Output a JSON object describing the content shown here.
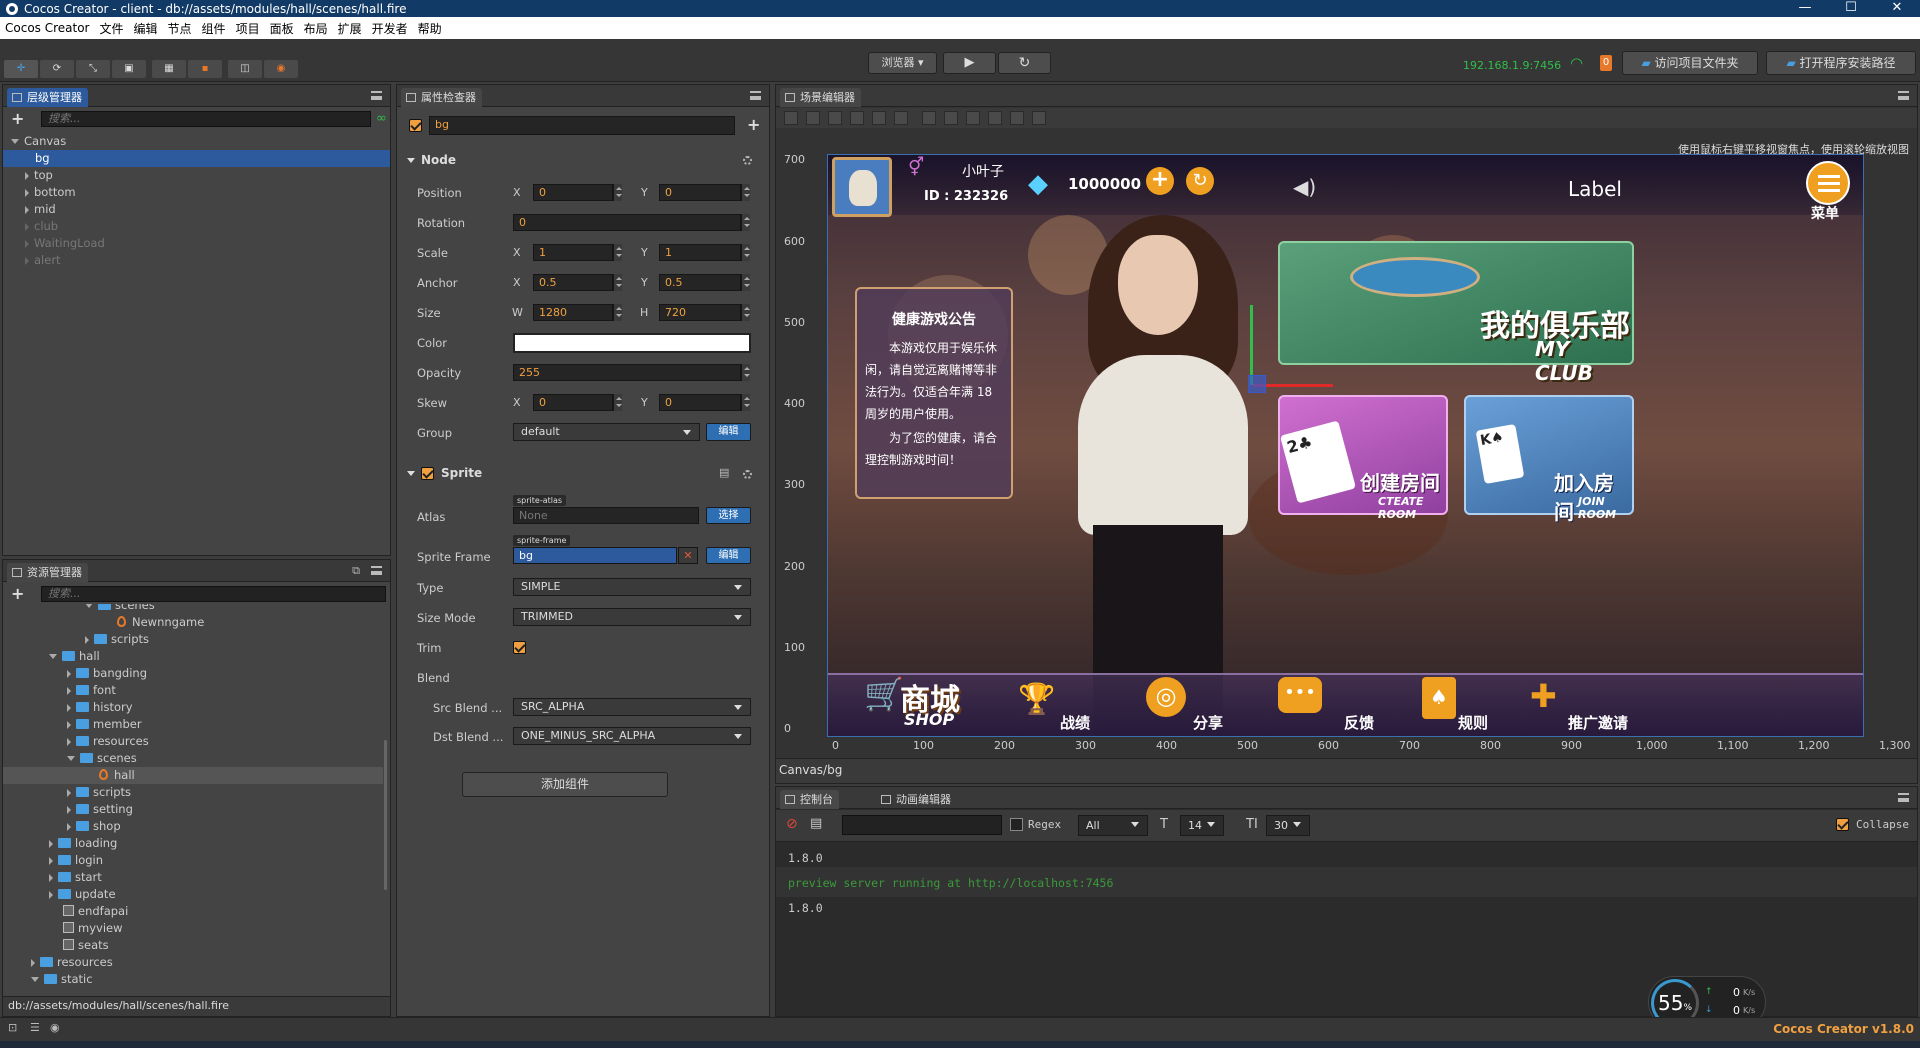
{
  "window": {
    "title": "Cocos Creator - client - db://assets/modules/hall/scenes/hall.fire",
    "minimize": "—",
    "maximize": "☐",
    "close": "✕"
  },
  "menu": [
    "Cocos Creator",
    "文件",
    "编辑",
    "节点",
    "组件",
    "项目",
    "面板",
    "布局",
    "扩展",
    "开发者",
    "帮助"
  ],
  "toolbar": {
    "browser_select": "浏览器",
    "play_icon": "▶",
    "refresh_icon": "↻",
    "ip": "192.168.1.9:7456",
    "badge": "0",
    "open_project_folder": "访问项目文件夹",
    "open_install_path": "打开程序安装路径"
  },
  "hierarchy": {
    "tab": "层级管理器",
    "search_placeholder": "搜索...",
    "items": [
      {
        "label": "Canvas"
      },
      {
        "label": "bg"
      },
      {
        "label": "top"
      },
      {
        "label": "bottom"
      },
      {
        "label": "mid"
      },
      {
        "label": "club"
      },
      {
        "label": "WaitingLoad"
      },
      {
        "label": "alert"
      }
    ]
  },
  "assets": {
    "tab": "资源管理器",
    "search_placeholder": "搜索...",
    "items": [
      {
        "label": "scenes"
      },
      {
        "label": "Newnngame"
      },
      {
        "label": "scripts"
      },
      {
        "label": "hall"
      },
      {
        "label": "bangding"
      },
      {
        "label": "font"
      },
      {
        "label": "history"
      },
      {
        "label": "member"
      },
      {
        "label": "resources"
      },
      {
        "label": "scenes"
      },
      {
        "label": "hall"
      },
      {
        "label": "scripts"
      },
      {
        "label": "setting"
      },
      {
        "label": "shop"
      },
      {
        "label": "loading"
      },
      {
        "label": "login"
      },
      {
        "label": "start"
      },
      {
        "label": "update"
      },
      {
        "label": "endfapai"
      },
      {
        "label": "myview"
      },
      {
        "label": "seats"
      },
      {
        "label": "resources"
      },
      {
        "label": "static"
      }
    ],
    "path": "db://assets/modules/hall/scenes/hall.fire"
  },
  "inspector": {
    "tab": "属性检查器",
    "node_name": "bg",
    "node_section": "Node",
    "position": {
      "label": "Position",
      "x": "0",
      "y": "0"
    },
    "rotation": {
      "label": "Rotation",
      "value": "0"
    },
    "scale": {
      "label": "Scale",
      "x": "1",
      "y": "1"
    },
    "anchor": {
      "label": "Anchor",
      "x": "0.5",
      "y": "0.5"
    },
    "size": {
      "label": "Size",
      "w": "1280",
      "h": "720"
    },
    "color": {
      "label": "Color",
      "value": "#ffffff"
    },
    "opacity": {
      "label": "Opacity",
      "value": "255"
    },
    "skew": {
      "label": "Skew",
      "x": "0",
      "y": "0"
    },
    "group": {
      "label": "Group",
      "value": "default",
      "edit": "编辑"
    },
    "axis": {
      "x": "X",
      "y": "Y",
      "w": "W",
      "h": "H"
    },
    "sprite_section": "Sprite",
    "atlas": {
      "label": "Atlas",
      "tag": "sprite-atlas",
      "value": "None",
      "btn": "选择"
    },
    "sprite_frame": {
      "label": "Sprite Frame",
      "tag": "sprite-frame",
      "value": "bg",
      "btn": "编辑",
      "clear": "✕"
    },
    "type": {
      "label": "Type",
      "value": "SIMPLE"
    },
    "size_mode": {
      "label": "Size Mode",
      "value": "TRIMMED"
    },
    "trim": {
      "label": "Trim"
    },
    "blend": {
      "label": "Blend"
    },
    "src_blend": {
      "label": "Src Blend ...",
      "value": "SRC_ALPHA"
    },
    "dst_blend": {
      "label": "Dst Blend ...",
      "value": "ONE_MINUS_SRC_ALPHA"
    },
    "add_component": "添加组件"
  },
  "scene": {
    "tab": "场景编辑器",
    "hint": "使用鼠标右键平移视窗焦点，使用滚轮缩放视图",
    "y_ticks": [
      "700",
      "600",
      "500",
      "400",
      "300",
      "200",
      "100",
      "0"
    ],
    "x_ticks": [
      "0",
      "100",
      "200",
      "300",
      "400",
      "500",
      "600",
      "700",
      "800",
      "900",
      "1,000",
      "1,100",
      "1,200",
      "1,300"
    ],
    "breadcrumb": "Canvas/bg"
  },
  "game": {
    "player_name": "小叶子",
    "player_id": "ID : 232326",
    "coins": "1000000",
    "label": "Label",
    "menu": "菜单",
    "notice_title": "健康游戏公告",
    "notice_body": "本游戏仅用于娱乐休闲，请自觉远离赌博等非法行为。仅适合年满 18 周岁的用户使用。",
    "notice_body2": "为了您的健康，请合理控制游戏时间！",
    "club_cn": "我的俱乐部",
    "club_en": "MY CLUB",
    "create_cn": "创建房间",
    "create_en": "CTEATE ROOM",
    "join_cn": "加入房间",
    "join_en": "JOIN ROOM",
    "shop_cn": "商城",
    "shop_en": "SHOP",
    "bottom": [
      "战绩",
      "分享",
      "反馈",
      "规则",
      "推广邀请"
    ]
  },
  "console": {
    "tab": "控制台",
    "tab2": "动画编辑器",
    "regex": "Regex",
    "level": "All",
    "font_size": "14",
    "line_height": "30",
    "collapse": "Collapse",
    "lines": [
      {
        "text": "1.8.0",
        "color": "#cccccc"
      },
      {
        "text": "preview server running at http://localhost:7456",
        "color": "#3a9a3a"
      },
      {
        "text": "1.8.0",
        "color": "#cccccc"
      }
    ]
  },
  "status": {
    "cpu_percent": "55",
    "cpu_unit": "%",
    "up": "0",
    "down": "0",
    "unit": "K/s",
    "version": "Cocos Creator v1.8.0"
  }
}
